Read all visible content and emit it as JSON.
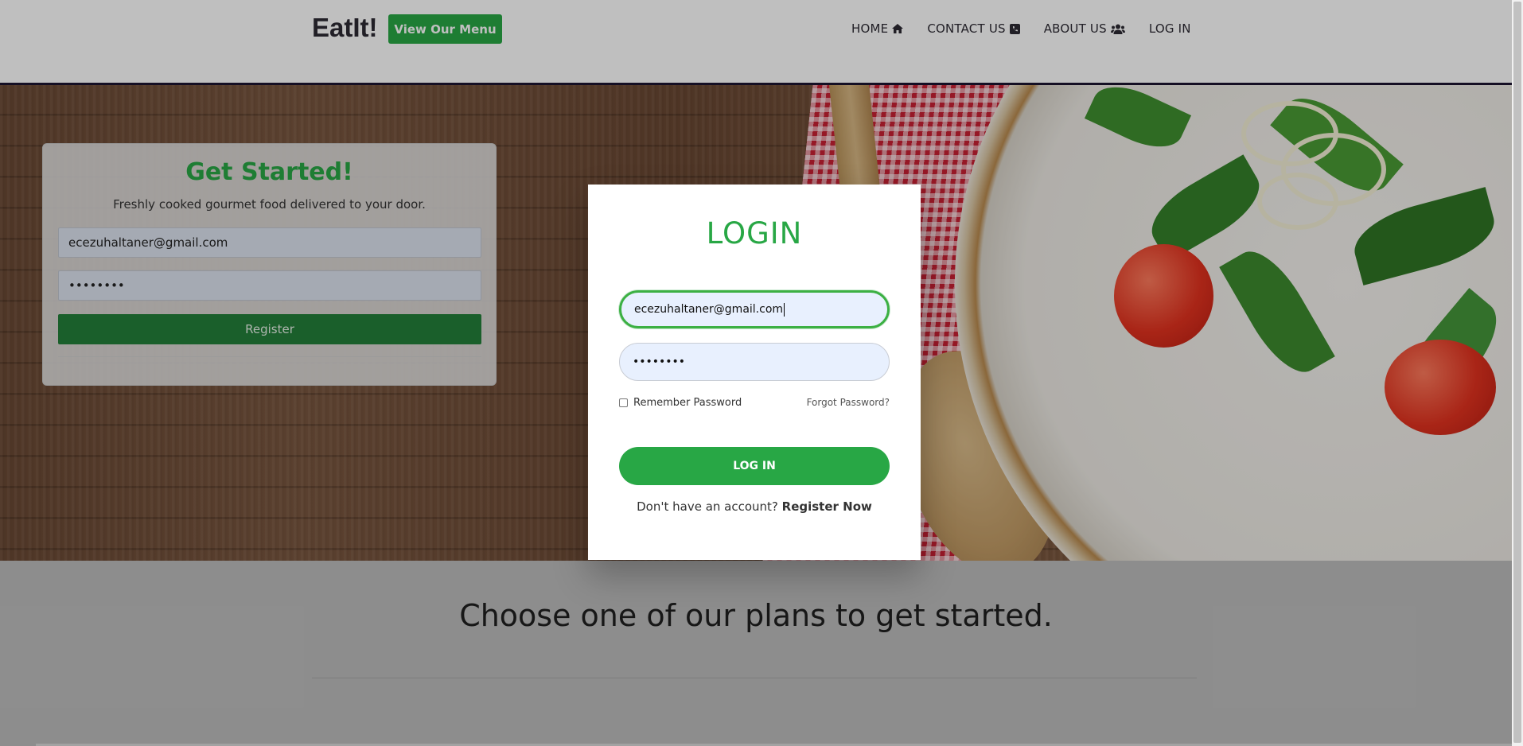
{
  "header": {
    "brand": "EatIt!",
    "menu_button": "View Our Menu",
    "nav": [
      {
        "label": "HOME",
        "icon": "home-icon"
      },
      {
        "label": "CONTACT US",
        "icon": "phone-square-icon"
      },
      {
        "label": "ABOUT US",
        "icon": "users-icon"
      },
      {
        "label": "LOG IN"
      }
    ]
  },
  "signup": {
    "title": "Get Started!",
    "subtitle": "Freshly cooked gourmet food delivered to your door.",
    "email_value": "ecezuhaltaner@gmail.com",
    "password_value": "••••••••",
    "button": "Register"
  },
  "plans": {
    "title": "Choose one of our plans to get started."
  },
  "login": {
    "title": "LOGIN",
    "email_value": "ecezuhaltaner@gmail.com",
    "password_value": "••••••••",
    "remember_label": "Remember Password",
    "forgot_label": "Forgot Password?",
    "button": "LOG IN",
    "register_prompt": "Don't have an account?",
    "register_link": "Register Now"
  },
  "colors": {
    "accent": "#28a745",
    "brand_text": "#2d2a33"
  }
}
